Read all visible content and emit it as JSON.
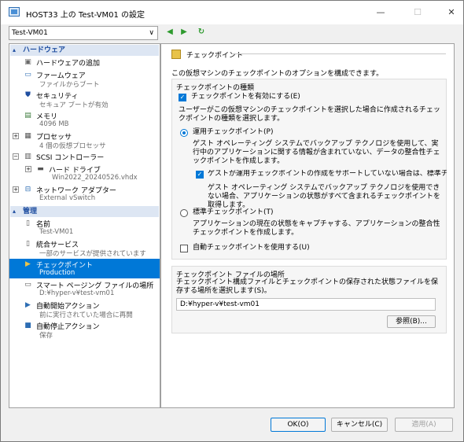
{
  "window": {
    "title": "HOST33 上の Test-VM01 の設定"
  },
  "vm_selector": {
    "value": "Test-VM01"
  },
  "nav": {
    "prev": "◀",
    "next": "▶",
    "refresh": "↻"
  },
  "sidebar": {
    "hardware_header": "ハードウェア",
    "management_header": "管理",
    "items": [
      {
        "label": "ハードウェアの追加",
        "sub": ""
      },
      {
        "label": "ファームウェア",
        "sub": "ファイルからブート"
      },
      {
        "label": "セキュリティ",
        "sub": "セキュア ブートが有効"
      },
      {
        "label": "メモリ",
        "sub": "4096 MB"
      },
      {
        "label": "プロセッサ",
        "sub": "4 個の仮想プロセッサ"
      },
      {
        "label": "SCSI コントローラー",
        "sub": ""
      },
      {
        "label": "ハード ドライブ",
        "sub": "Win2022_20240526.vhdx"
      },
      {
        "label": "ネットワーク アダプター",
        "sub": "External vSwitch"
      },
      {
        "label": "名前",
        "sub": "Test-VM01"
      },
      {
        "label": "統合サービス",
        "sub": "一部のサービスが提供されています"
      },
      {
        "label": "チェックポイント",
        "sub": "Production"
      },
      {
        "label": "スマート ページング ファイルの場所",
        "sub": "D:¥hyper-v¥test-vm01"
      },
      {
        "label": "自動開始アクション",
        "sub": "前に実行されていた場合に再開"
      },
      {
        "label": "自動停止アクション",
        "sub": "保存"
      }
    ]
  },
  "main": {
    "section_title": "チェックポイント",
    "description": "この仮想マシンのチェックポイントのオプションを構成できます。",
    "type_group": {
      "title": "チェックポイントの種類",
      "enable_label": "チェックポイントを有効にする(E)",
      "enable_checked": true,
      "choose_text": "ユーザーがこの仮想マシンのチェックポイントを選択した場合に作成されるチェックポイントの種類を選択します。",
      "production_label": "運用チェックポイント(P)",
      "production_selected": true,
      "production_desc": "ゲスト オペレーティング システムでバックアップ テクノロジを使用して、実行中のアプリケーションに関する情報が含まれていない、データの整合性チェックポイントを作成します。",
      "fallback_label": "ゲストが運用チェックポイントの作成をサポートしていない場合は、標準チェックポイ",
      "fallback_checked": true,
      "fallback_desc": "ゲスト オペレーティング システムでバックアップ テクノロジを使用できない場合、アプリケーションの状態がすべて含まれるチェックポイントを取得します。",
      "standard_label": "標準チェックポイント(T)",
      "standard_selected": false,
      "standard_desc": "アプリケーションの現在の状態をキャプチャする、アプリケーションの整合性チェックポイントを作成します。",
      "auto_label": "自動チェックポイントを使用する(U)",
      "auto_checked": false
    },
    "location_group": {
      "title": "チェックポイント ファイルの場所",
      "desc": "チェックポイント構成ファイルとチェックポイントの保存された状態ファイルを保存する場所を選択します(S)。",
      "path": "D:¥hyper-v¥test-vm01",
      "browse_label": "参照(B)..."
    }
  },
  "footer": {
    "ok": "OK(O)",
    "cancel": "キャンセル(C)",
    "apply": "適用(A)"
  },
  "window_buttons": {
    "minimize": "—",
    "maximize": "☐",
    "close": "✕"
  },
  "colors": {
    "accent": "#0078d7",
    "section_header_bg": "#dde6f3",
    "section_header_text": "#1f4ea0"
  }
}
